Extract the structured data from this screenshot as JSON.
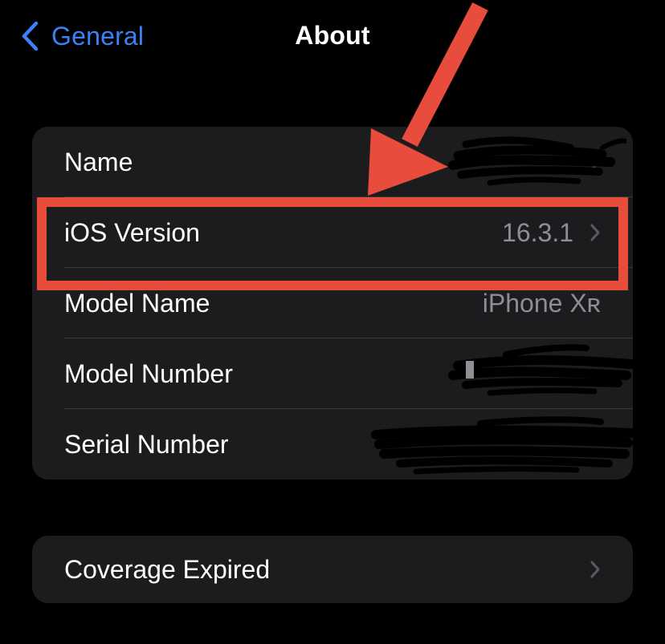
{
  "nav": {
    "back_label": "General",
    "title": "About"
  },
  "info_rows": [
    {
      "label": "Name",
      "value": "",
      "value_redacted": true,
      "chevron": true
    },
    {
      "label": "iOS Version",
      "value": "16.3.1",
      "chevron": true,
      "highlighted": true
    },
    {
      "label": "Model Name",
      "value": "iPhone Xʀ",
      "chevron": false
    },
    {
      "label": "Model Number",
      "value": "",
      "value_redacted": true,
      "chevron": false
    },
    {
      "label": "Serial Number",
      "value": "",
      "value_redacted": true,
      "chevron": false
    }
  ],
  "coverage_row": {
    "label": "Coverage Expired",
    "chevron": true
  },
  "colors": {
    "background": "#000000",
    "group_background": "#1c1c1e",
    "accent_blue": "#3a82f7",
    "secondary_text": "#8e8e93",
    "annotation_red": "#e84c3d"
  },
  "icons": [
    "chevron-left-icon",
    "chevron-right-icon",
    "annotation-arrow"
  ]
}
